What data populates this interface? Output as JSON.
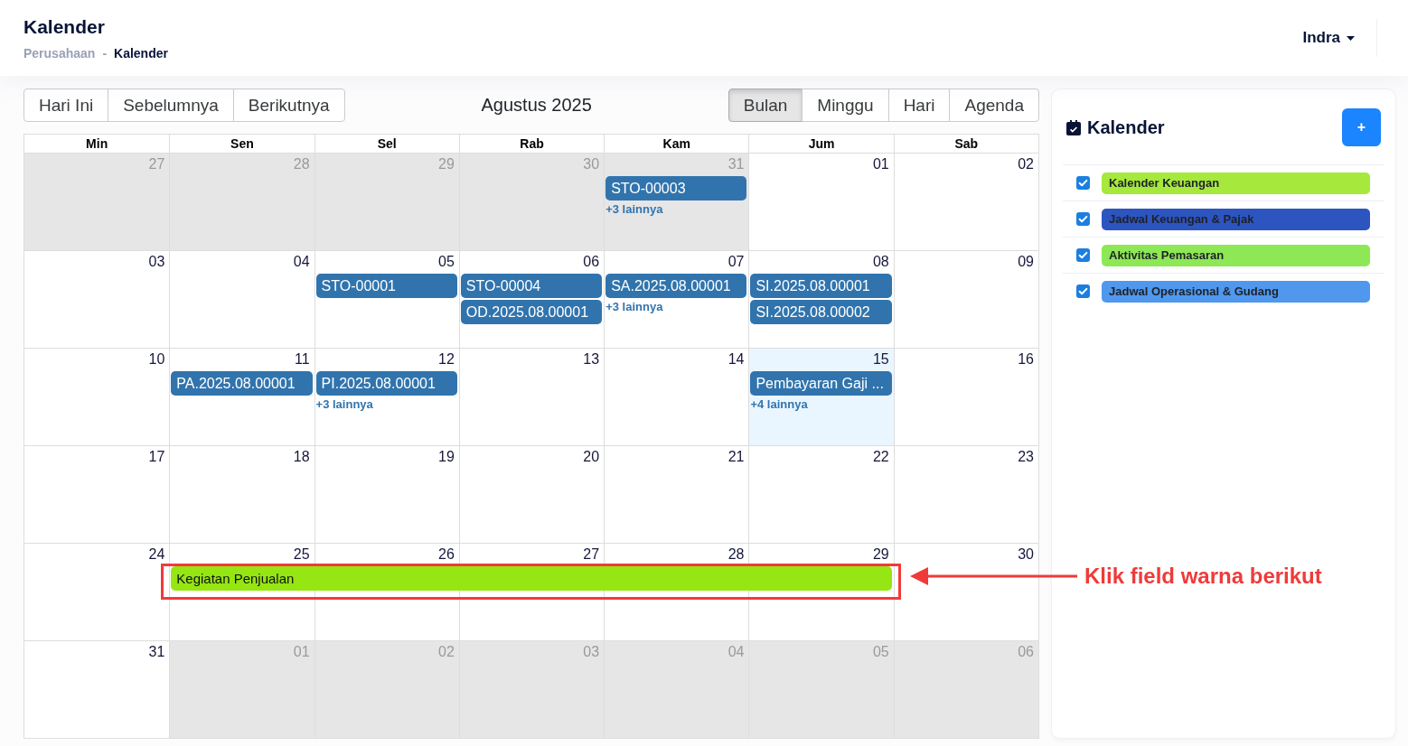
{
  "header": {
    "title": "Kalender",
    "breadcrumb": {
      "separator": "-",
      "items": [
        {
          "label": "Perusahaan",
          "current": false
        },
        {
          "label": "Kalender",
          "current": true
        }
      ]
    },
    "user": "Indra"
  },
  "toolbar": {
    "nav": [
      "Hari Ini",
      "Sebelumnya",
      "Berikutnya"
    ],
    "label": "Agustus 2025",
    "views": [
      {
        "label": "Bulan",
        "selected": true
      },
      {
        "label": "Minggu",
        "selected": false
      },
      {
        "label": "Hari",
        "selected": false
      },
      {
        "label": "Agenda",
        "selected": false
      }
    ]
  },
  "weekdays": [
    "Min",
    "Sen",
    "Sel",
    "Rab",
    "Kam",
    "Jum",
    "Sab"
  ],
  "weeks": [
    {
      "days": [
        {
          "date": "27",
          "outside": true,
          "today": false
        },
        {
          "date": "28",
          "outside": true,
          "today": false
        },
        {
          "date": "29",
          "outside": true,
          "today": false
        },
        {
          "date": "30",
          "outside": true,
          "today": false
        },
        {
          "date": "31",
          "outside": true,
          "today": false,
          "events": [
            {
              "title": "STO-00003",
              "color": "#3174ad"
            }
          ],
          "more": "+3 lainnya"
        },
        {
          "date": "01",
          "outside": false,
          "today": false
        },
        {
          "date": "02",
          "outside": false,
          "today": false
        }
      ]
    },
    {
      "days": [
        {
          "date": "03",
          "outside": false,
          "today": false
        },
        {
          "date": "04",
          "outside": false,
          "today": false
        },
        {
          "date": "05",
          "outside": false,
          "today": false,
          "events": [
            {
              "title": "STO-00001",
              "color": "#3174ad"
            }
          ]
        },
        {
          "date": "06",
          "outside": false,
          "today": false,
          "events": [
            {
              "title": "STO-00004",
              "color": "#3174ad"
            },
            {
              "title": "OD.2025.08.00001",
              "color": "#3174ad"
            }
          ]
        },
        {
          "date": "07",
          "outside": false,
          "today": false,
          "events": [
            {
              "title": "SA.2025.08.00001",
              "color": "#3174ad"
            }
          ],
          "more": "+3 lainnya"
        },
        {
          "date": "08",
          "outside": false,
          "today": false,
          "events": [
            {
              "title": "SI.2025.08.00001",
              "color": "#3174ad"
            },
            {
              "title": "SI.2025.08.00002",
              "color": "#3174ad"
            }
          ]
        },
        {
          "date": "09",
          "outside": false,
          "today": false
        }
      ]
    },
    {
      "days": [
        {
          "date": "10",
          "outside": false,
          "today": false
        },
        {
          "date": "11",
          "outside": false,
          "today": false,
          "events": [
            {
              "title": "PA.2025.08.00001",
              "color": "#3174ad"
            }
          ]
        },
        {
          "date": "12",
          "outside": false,
          "today": false,
          "events": [
            {
              "title": "PI.2025.08.00001",
              "color": "#3174ad"
            }
          ],
          "more": "+3 lainnya"
        },
        {
          "date": "13",
          "outside": false,
          "today": false
        },
        {
          "date": "14",
          "outside": false,
          "today": false
        },
        {
          "date": "15",
          "outside": false,
          "today": true,
          "events": [
            {
              "title": "Pembayaran Gaji ...",
              "color": "#3174ad"
            }
          ],
          "more": "+4 lainnya"
        },
        {
          "date": "16",
          "outside": false,
          "today": false
        }
      ]
    },
    {
      "days": [
        {
          "date": "17",
          "outside": false,
          "today": false
        },
        {
          "date": "18",
          "outside": false,
          "today": false
        },
        {
          "date": "19",
          "outside": false,
          "today": false
        },
        {
          "date": "20",
          "outside": false,
          "today": false
        },
        {
          "date": "21",
          "outside": false,
          "today": false
        },
        {
          "date": "22",
          "outside": false,
          "today": false
        },
        {
          "date": "23",
          "outside": false,
          "today": false
        }
      ]
    },
    {
      "bar": {
        "title": "Kegiatan Penjualan",
        "color": "#95e612"
      },
      "days": [
        {
          "date": "24",
          "outside": false,
          "today": false,
          "covered": false
        },
        {
          "date": "25",
          "outside": false,
          "today": false,
          "covered": true
        },
        {
          "date": "26",
          "outside": false,
          "today": false,
          "covered": true
        },
        {
          "date": "27",
          "outside": false,
          "today": false,
          "covered": true
        },
        {
          "date": "28",
          "outside": false,
          "today": false,
          "covered": true
        },
        {
          "date": "29",
          "outside": false,
          "today": false,
          "covered": true
        },
        {
          "date": "30",
          "outside": false,
          "today": false,
          "covered": false
        }
      ]
    },
    {
      "days": [
        {
          "date": "31",
          "outside": false,
          "today": false
        },
        {
          "date": "01",
          "outside": true,
          "today": false
        },
        {
          "date": "02",
          "outside": true,
          "today": false
        },
        {
          "date": "03",
          "outside": true,
          "today": false
        },
        {
          "date": "04",
          "outside": true,
          "today": false
        },
        {
          "date": "05",
          "outside": true,
          "today": false
        },
        {
          "date": "06",
          "outside": true,
          "today": false
        }
      ]
    }
  ],
  "sidebar": {
    "title": "Kalender",
    "add_button": "+",
    "calendars": [
      {
        "label": "Kalender Keuangan",
        "color": "#a6e83c",
        "checked": true
      },
      {
        "label": "Jadwal Keuangan & Pajak",
        "color": "#2c55c0",
        "checked": true
      },
      {
        "label": "Aktivitas Pemasaran",
        "color": "#8ee855",
        "checked": true
      },
      {
        "label": "Jadwal Operasional & Gudang",
        "color": "#4f98ee",
        "checked": true
      }
    ]
  },
  "annotation": {
    "text": "Klik field warna berikut"
  }
}
